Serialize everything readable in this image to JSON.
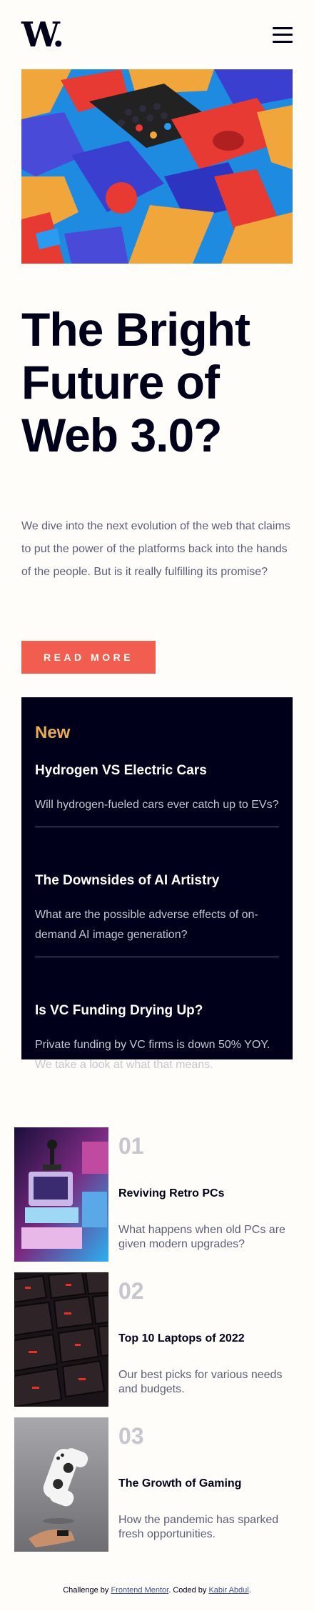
{
  "header": {
    "logo": "W.",
    "menu_icon": "hamburger-menu-icon"
  },
  "hero": {
    "image_icon": "abstract-3d-blocks-image",
    "title": "The Bright Future of Web 3.0?",
    "lede": "We dive into the next evolution of the web that claims to put the power of the platforms back into the hands of the people. But is it really fulfilling its promise?",
    "cta_label": "READ MORE"
  },
  "new_panel": {
    "heading": "New",
    "items": [
      {
        "title": "Hydrogen VS Electric Cars",
        "text": "Will hydrogen-fueled cars ever catch up to EVs?"
      },
      {
        "title": "The Downsides of AI Artistry",
        "text": "What are the possible adverse effects of on-demand AI image generation?"
      },
      {
        "title": "Is VC Funding Drying Up?",
        "text": "Private funding by VC firms is down 50% YOY. We take a look at what that means."
      }
    ]
  },
  "articles": [
    {
      "number": "01",
      "title": "Reviving Retro PCs",
      "text": "What happens when old PCs are given modern upgrades?",
      "image_icon": "retro-pc-image"
    },
    {
      "number": "02",
      "title": "Top 10 Laptops of 2022",
      "text": "Our best picks for various needs and budgets.",
      "image_icon": "laptop-keyboard-image"
    },
    {
      "number": "03",
      "title": "The Growth of Gaming",
      "text": "How the pandemic has sparked fresh opportunities.",
      "image_icon": "game-controller-image"
    }
  ],
  "footer": {
    "prefix": "Challenge by ",
    "link1": "Frontend Mentor",
    "middle": ". Coded by ",
    "link2": "Kabir Abdul",
    "suffix": "."
  },
  "colors": {
    "accent": "#f15e50",
    "accent_soft": "#e9ab53",
    "dark": "#00001a",
    "muted": "#5d5f79",
    "background": "#fffdfa"
  }
}
